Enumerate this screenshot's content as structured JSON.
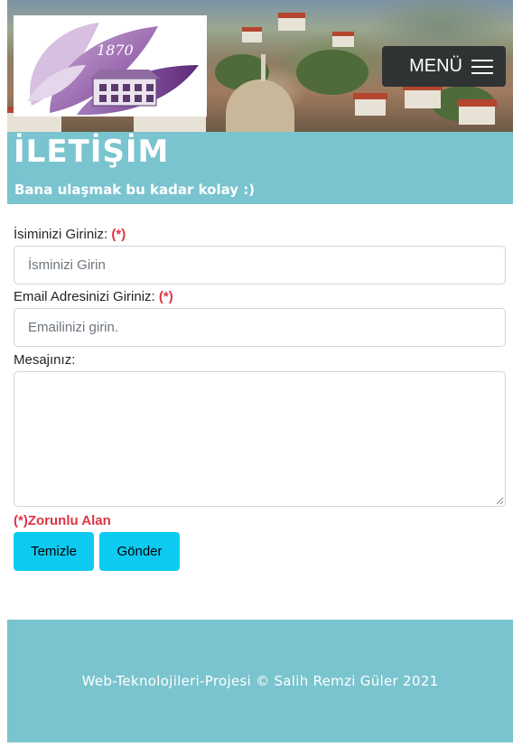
{
  "header": {
    "logo_year": "1870",
    "menu_label": "MENÜ"
  },
  "contact": {
    "title": "İLETİŞİM",
    "subtitle": "Bana ulaşmak bu kadar kolay :)"
  },
  "form": {
    "name_label": "İsiminizi Giriniz:",
    "name_required": "(*)",
    "name_placeholder": "İsminizi Girin",
    "email_label": "Email Adresinizi Giriniz:",
    "email_required": "(*)",
    "email_placeholder": "Emailinizi girin.",
    "message_label": "Mesajınız:",
    "required_note": "(*)Zorunlu Alan",
    "reset_label": "Temizle",
    "submit_label": "Gönder"
  },
  "footer": {
    "text": "Web-Teknolojileri-Projesi © Salih Remzi Güler 2021"
  },
  "colors": {
    "accent_band": "#7ac4cf",
    "button": "#0dcaf0",
    "required": "#dc3545",
    "menu_bg": "#2f3334"
  }
}
